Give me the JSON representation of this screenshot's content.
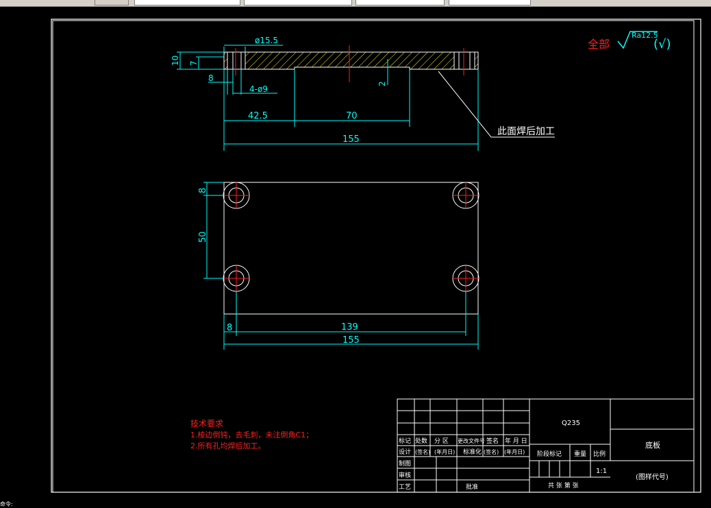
{
  "toolbar": {
    "fields": [
      "",
      "",
      "",
      "",
      ""
    ]
  },
  "drawing": {
    "roughness": {
      "prefix": "全部",
      "ra": "Ra12.5",
      "suffix": "(√)"
    },
    "side_view": {
      "dims": {
        "dia_hole": "ø15.5",
        "height_total": "10",
        "height_plate": "7",
        "offset": "8",
        "holes": "4-ø9",
        "step": "2",
        "pos": "42.5",
        "slot": "70",
        "length": "155"
      },
      "note": "此面焊后加工"
    },
    "top_view": {
      "dims": {
        "offset_y": "8",
        "spacing_y": "50",
        "offset_x": "8",
        "spacing_x": "139",
        "length": "155"
      }
    },
    "tech_req": {
      "title": "技术要求",
      "items": [
        "1.棱边倒钝，去毛刺，未注倒角C1；",
        "2.所有孔均焊后加工。"
      ]
    },
    "title_block": {
      "material": "Q235",
      "part_name": "底板",
      "drawing_no": "(图样代号)",
      "scale": "1:1",
      "headers": [
        "标记",
        "处数",
        "分 区",
        "更改文件号",
        "签名",
        "年 月 日"
      ],
      "row_design": [
        "设计",
        "(签名)",
        "(年月日)",
        "标准化",
        "(签名)",
        "(年月日)"
      ],
      "labels_left": [
        "制图",
        "审核",
        "工艺"
      ],
      "approve": "批准",
      "stage": "阶段标记",
      "weight": "重量",
      "ratio": "比例",
      "sheets": "共 张 第 张"
    }
  },
  "status_text": "命令:"
}
